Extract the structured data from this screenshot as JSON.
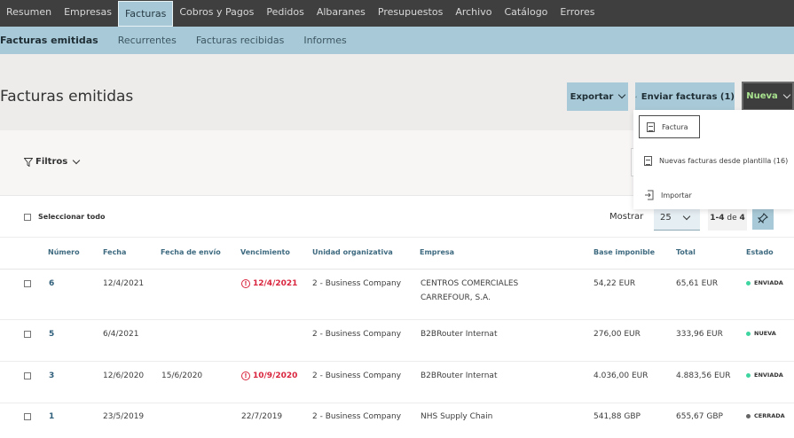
{
  "topnav": {
    "items": [
      "Resumen",
      "Empresas",
      "Facturas",
      "Cobros y Pagos",
      "Pedidos",
      "Albaranes",
      "Presupuestos",
      "Archivo",
      "Catálogo",
      "Errores"
    ],
    "active_index": 2
  },
  "subnav": {
    "items": [
      "Facturas emitidas",
      "Recurrentes",
      "Facturas recibidas",
      "Informes"
    ],
    "active_index": 0
  },
  "header": {
    "title": "Facturas emitidas",
    "export_label": "Exportar",
    "send_label": "Enviar facturas (1)",
    "new_label": "Nueva"
  },
  "new_menu": {
    "items": [
      "Factura",
      "Nuevas facturas desde plantilla (16)",
      "Importar"
    ]
  },
  "filters": {
    "label": "Filtros"
  },
  "toolbar": {
    "select_all": "Seleccionar todo",
    "show_label": "Mostrar",
    "per_page": "25",
    "range": "1-4",
    "of_label": "de",
    "total": "4"
  },
  "table": {
    "columns": [
      "Número",
      "Fecha",
      "Fecha de envío",
      "Vencimiento",
      "Unidad organizativa",
      "Empresa",
      "Base imponible",
      "Total",
      "Estado"
    ],
    "rows": [
      {
        "number": "6",
        "date": "12/4/2021",
        "sent": "",
        "due": "12/4/2021",
        "due_overdue": true,
        "unit": "2 - Business Company",
        "company_l1": "CENTROS COMERCIALES",
        "company_l2": "CARREFOUR, S.A.",
        "base": "54,22 EUR",
        "total": "65,61 EUR",
        "status": "ENVIADA",
        "status_color": "#3fd5a1"
      },
      {
        "number": "5",
        "date": "6/4/2021",
        "sent": "",
        "due": "",
        "due_overdue": false,
        "unit": "2 - Business Company",
        "company_l1": "B2BRouter Internat",
        "company_l2": "",
        "base": "276,00 EUR",
        "total": "333,96 EUR",
        "status": "NUEVA",
        "status_color": "#3fd5a1"
      },
      {
        "number": "3",
        "date": "12/6/2020",
        "sent": "15/6/2020",
        "due": "10/9/2020",
        "due_overdue": true,
        "unit": "2 - Business Company",
        "company_l1": "B2BRouter Internat",
        "company_l2": "",
        "base": "4.036,00 EUR",
        "total": "4.883,56 EUR",
        "status": "ENVIADA",
        "status_color": "#3fd5a1"
      },
      {
        "number": "1",
        "date": "23/5/2019",
        "sent": "",
        "due": "22/7/2019",
        "due_overdue": false,
        "unit": "2 - Business Company",
        "company_l1": "NHS Supply Chain",
        "company_l2": "",
        "base": "541,88 GBP",
        "total": "655,67 GBP",
        "status": "CERRADA",
        "status_color": "#666666"
      }
    ]
  },
  "colors": {
    "topnav_bg": "#3f3f3f",
    "accent": "#a8c9d7",
    "overdue": "#d9243d",
    "new_button_text": "#a8e28e"
  }
}
